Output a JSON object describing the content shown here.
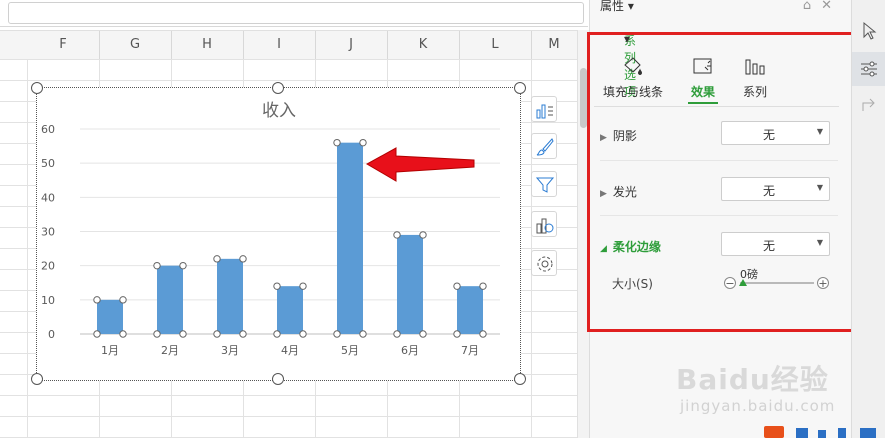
{
  "columns": [
    "F",
    "G",
    "H",
    "I",
    "J",
    "K",
    "L",
    "M"
  ],
  "chart_data": {
    "type": "bar",
    "title": "收入",
    "categories": [
      "1月",
      "2月",
      "3月",
      "4月",
      "5月",
      "6月",
      "7月"
    ],
    "values": [
      10,
      20,
      22,
      14,
      56,
      29,
      14
    ],
    "ylim": [
      0,
      60
    ],
    "yticks": [
      "0",
      "10",
      "20",
      "30",
      "40",
      "50",
      "60"
    ],
    "grid": true,
    "bar_color": "#5b9bd5"
  },
  "panel": {
    "title": "属性",
    "dropdown_label": "系列选项",
    "tabs": [
      {
        "label": "填充与线条",
        "icon": "paint-bucket-icon"
      },
      {
        "label": "效果",
        "icon": "effects-icon"
      },
      {
        "label": "系列",
        "icon": "bar-series-icon"
      }
    ],
    "sections": [
      {
        "label": "阴影",
        "value": "无"
      },
      {
        "label": "发光",
        "value": "无"
      },
      {
        "label": "柔化边缘",
        "value": "无"
      }
    ],
    "size_label": "大小(S)",
    "size_value": "0磅"
  },
  "watermark": {
    "main": "Baidu经验",
    "sub": "jingyan.baidu.com"
  },
  "colors": {
    "accent_green": "#2e9d3a",
    "highlight_red": "#e02020",
    "arrow_red": "#e8101a"
  }
}
